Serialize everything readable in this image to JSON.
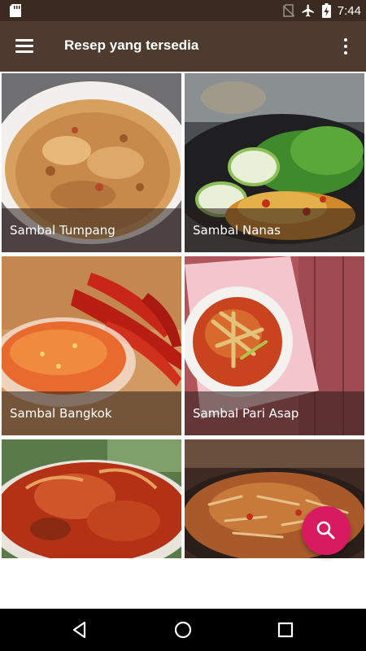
{
  "status_bar": {
    "time": "7:44",
    "icons": [
      "sd-card-icon",
      "no-sim-icon",
      "airplane-icon",
      "battery-charging-icon"
    ]
  },
  "app_bar": {
    "title": "Resep yang tersedia",
    "menu_icon": "hamburger-menu-icon",
    "more_icon": "more-vert-icon"
  },
  "recipes": [
    {
      "name": "Sambal Tumpang"
    },
    {
      "name": "Sambal Nanas"
    },
    {
      "name": "Sambal Bangkok"
    },
    {
      "name": "Sambal Pari Asap"
    },
    {
      "name": ""
    },
    {
      "name": ""
    }
  ],
  "fab": {
    "icon": "search-icon",
    "color": "#d81b60"
  },
  "nav_bar": {
    "icons": [
      "back-icon",
      "home-icon",
      "recents-icon"
    ]
  },
  "colors": {
    "status_bar": "#3b2a20",
    "app_bar": "#4e3b30",
    "accent": "#d81b60"
  }
}
